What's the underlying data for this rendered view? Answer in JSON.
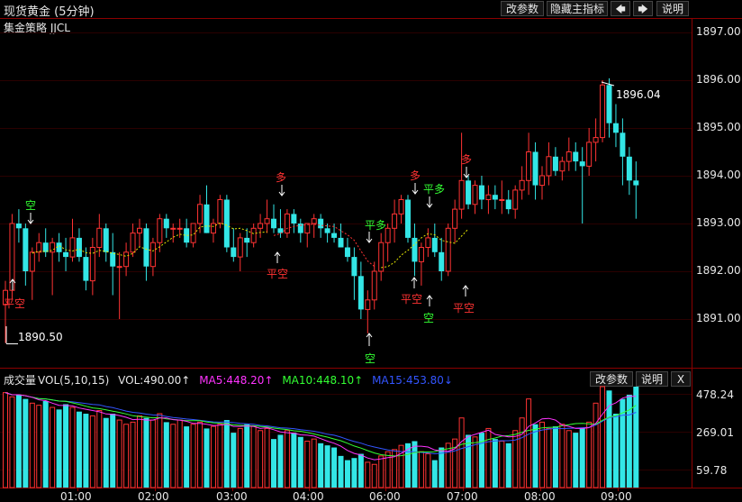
{
  "window": {
    "title": "现货黄金 (5分钟)"
  },
  "toolbar": {
    "modify_params": "改参数",
    "hide_main_indicator": "隐藏主指标",
    "prev_arrow": "🡄",
    "next_arrow": "🡆",
    "help": "说明"
  },
  "main_panel": {
    "indicator_name": "集金策略 JJCL",
    "high_label": "1896.04",
    "low_label": "1890.50",
    "price_axis": [
      "1897.00",
      "1896.00",
      "1895.00",
      "1894.00",
      "1893.00",
      "1892.00",
      "1891.00"
    ]
  },
  "volume_panel": {
    "name": "成交量",
    "indicator": "VOL(5,10,15)",
    "vol_value": "VOL:490.00↑",
    "ma5": "MA5:448.20↑",
    "ma10": "MA10:448.10↑",
    "ma15": "MA15:453.80↓",
    "modify_params": "改参数",
    "help": "说明",
    "close": "X",
    "axis": [
      "478.24",
      "269.01",
      "59.78"
    ]
  },
  "time_axis": [
    "01:00",
    "02:00",
    "03:00",
    "04:00",
    "06:00",
    "07:00",
    "08:00",
    "09:00"
  ],
  "signals": [
    "平空",
    "空",
    "多",
    "平空",
    "平多",
    "空",
    "多",
    "平多",
    "平空",
    "空",
    "多",
    "平空"
  ],
  "colors": {
    "up": "#ff3333",
    "down": "#33e6e6",
    "ma_main": "#e6e600",
    "ma5": "#ff33ff",
    "ma10": "#33ff33",
    "ma15": "#3355ff"
  },
  "chart_data": [
    {
      "type": "candlestick",
      "title": "现货黄金 (5分钟)",
      "x": [
        "01:00",
        "02:00",
        "03:00",
        "04:00",
        "06:00",
        "07:00",
        "08:00",
        "09:00"
      ],
      "ylim": [
        1890.3,
        1897.1
      ],
      "highlight": {
        "high": 1896.04,
        "low": 1890.5
      },
      "candles": [
        [
          1891.3,
          1891.8,
          1890.5,
          1891.6
        ],
        [
          1891.6,
          1893.2,
          1891.4,
          1893.0
        ],
        [
          1893.0,
          1893.3,
          1892.6,
          1892.9
        ],
        [
          1892.9,
          1893.0,
          1891.7,
          1892.0
        ],
        [
          1892.0,
          1892.5,
          1891.4,
          1892.4
        ],
        [
          1892.4,
          1892.8,
          1892.2,
          1892.6
        ],
        [
          1892.6,
          1892.9,
          1892.3,
          1892.4
        ],
        [
          1892.4,
          1892.7,
          1891.5,
          1892.6
        ],
        [
          1892.6,
          1892.8,
          1892.2,
          1892.4
        ],
        [
          1892.4,
          1892.7,
          1892.0,
          1892.3
        ],
        [
          1892.3,
          1893.1,
          1892.2,
          1892.7
        ],
        [
          1892.7,
          1892.9,
          1892.2,
          1892.3
        ],
        [
          1892.3,
          1892.5,
          1891.6,
          1891.8
        ],
        [
          1891.8,
          1892.7,
          1891.5,
          1892.5
        ],
        [
          1892.5,
          1893.2,
          1892.3,
          1892.9
        ],
        [
          1892.9,
          1893.0,
          1892.2,
          1892.4
        ],
        [
          1892.4,
          1892.8,
          1891.5,
          1892.1
        ],
        [
          1892.1,
          1892.4,
          1891.0,
          1892.1
        ],
        [
          1892.1,
          1892.6,
          1891.9,
          1892.4
        ],
        [
          1892.4,
          1893.0,
          1892.3,
          1892.8
        ],
        [
          1892.8,
          1893.1,
          1892.5,
          1892.9
        ],
        [
          1892.9,
          1893.0,
          1891.8,
          1892.1
        ],
        [
          1892.1,
          1892.7,
          1891.9,
          1892.6
        ],
        [
          1892.6,
          1893.2,
          1892.4,
          1893.1
        ],
        [
          1893.1,
          1893.2,
          1892.7,
          1892.9
        ],
        [
          1892.9,
          1893.0,
          1892.6,
          1892.9
        ],
        [
          1892.9,
          1893.1,
          1892.7,
          1892.9
        ],
        [
          1892.9,
          1893.1,
          1892.5,
          1892.6
        ],
        [
          1892.6,
          1893.0,
          1892.5,
          1893.0
        ],
        [
          1893.0,
          1893.6,
          1892.8,
          1893.4
        ],
        [
          1893.4,
          1893.8,
          1892.8,
          1892.8
        ],
        [
          1892.8,
          1893.1,
          1892.6,
          1893.0
        ],
        [
          1893.0,
          1893.6,
          1892.9,
          1893.5
        ],
        [
          1893.5,
          1893.6,
          1892.4,
          1892.5
        ],
        [
          1892.5,
          1892.9,
          1892.2,
          1892.3
        ],
        [
          1892.3,
          1892.8,
          1892.0,
          1892.7
        ],
        [
          1892.7,
          1892.9,
          1892.3,
          1892.6
        ],
        [
          1892.6,
          1893.0,
          1892.5,
          1892.9
        ],
        [
          1892.9,
          1893.2,
          1892.7,
          1893.0
        ],
        [
          1893.0,
          1893.5,
          1892.8,
          1893.1
        ],
        [
          1893.1,
          1893.4,
          1892.8,
          1892.9
        ],
        [
          1892.9,
          1893.3,
          1892.7,
          1892.8
        ],
        [
          1892.8,
          1893.3,
          1892.7,
          1893.2
        ],
        [
          1893.2,
          1893.3,
          1892.8,
          1893.0
        ],
        [
          1893.0,
          1893.1,
          1892.6,
          1892.8
        ],
        [
          1892.8,
          1893.0,
          1892.5,
          1893.0
        ],
        [
          1893.0,
          1893.2,
          1892.7,
          1893.1
        ],
        [
          1893.1,
          1893.2,
          1892.7,
          1892.9
        ],
        [
          1892.9,
          1893.0,
          1892.6,
          1892.8
        ],
        [
          1892.8,
          1893.0,
          1892.6,
          1892.7
        ],
        [
          1892.7,
          1893.0,
          1892.5,
          1892.5
        ],
        [
          1892.5,
          1892.7,
          1892.2,
          1892.3
        ],
        [
          1892.3,
          1892.5,
          1891.4,
          1891.9
        ],
        [
          1891.9,
          1892.2,
          1891.0,
          1891.2
        ],
        [
          1891.2,
          1891.6,
          1890.7,
          1891.4
        ],
        [
          1891.4,
          1892.2,
          1891.2,
          1892.0
        ],
        [
          1892.0,
          1892.8,
          1891.8,
          1892.6
        ],
        [
          1892.6,
          1893.0,
          1892.2,
          1892.9
        ],
        [
          1892.9,
          1893.5,
          1892.6,
          1893.2
        ],
        [
          1893.2,
          1893.6,
          1893.0,
          1893.5
        ],
        [
          1893.5,
          1893.6,
          1892.6,
          1892.7
        ],
        [
          1892.7,
          1893.0,
          1891.9,
          1892.2
        ],
        [
          1892.2,
          1892.6,
          1891.7,
          1892.5
        ],
        [
          1892.5,
          1892.9,
          1892.3,
          1892.7
        ],
        [
          1892.7,
          1893.0,
          1892.3,
          1892.4
        ],
        [
          1892.4,
          1892.7,
          1891.8,
          1892.0
        ],
        [
          1892.0,
          1893.0,
          1891.9,
          1892.9
        ],
        [
          1892.9,
          1893.5,
          1892.6,
          1893.3
        ],
        [
          1893.3,
          1894.9,
          1893.1,
          1893.9
        ],
        [
          1893.9,
          1894.0,
          1893.3,
          1893.4
        ],
        [
          1893.4,
          1893.9,
          1893.2,
          1893.8
        ],
        [
          1893.8,
          1894.0,
          1893.3,
          1893.5
        ],
        [
          1893.5,
          1893.8,
          1893.2,
          1893.6
        ],
        [
          1893.6,
          1893.8,
          1893.3,
          1893.5
        ],
        [
          1893.5,
          1893.9,
          1893.2,
          1893.5
        ],
        [
          1893.5,
          1893.7,
          1893.2,
          1893.3
        ],
        [
          1893.3,
          1893.8,
          1893.1,
          1893.7
        ],
        [
          1893.7,
          1894.2,
          1893.5,
          1893.9
        ],
        [
          1893.9,
          1894.9,
          1893.6,
          1894.5
        ],
        [
          1894.5,
          1894.7,
          1893.5,
          1893.8
        ],
        [
          1893.8,
          1894.2,
          1893.5,
          1894.0
        ],
        [
          1894.0,
          1894.7,
          1893.8,
          1894.4
        ],
        [
          1894.4,
          1894.6,
          1894.0,
          1894.1
        ],
        [
          1894.1,
          1894.4,
          1893.9,
          1894.3
        ],
        [
          1894.3,
          1894.8,
          1894.1,
          1894.5
        ],
        [
          1894.5,
          1894.7,
          1894.1,
          1894.3
        ],
        [
          1894.3,
          1894.6,
          1893.0,
          1894.2
        ],
        [
          1894.2,
          1895.0,
          1894.0,
          1894.7
        ],
        [
          1894.7,
          1895.2,
          1894.3,
          1894.8
        ],
        [
          1894.8,
          1896.0,
          1894.7,
          1895.9
        ],
        [
          1895.9,
          1896.04,
          1894.8,
          1895.1
        ],
        [
          1895.1,
          1895.5,
          1894.6,
          1894.9
        ],
        [
          1894.9,
          1895.2,
          1893.8,
          1894.4
        ],
        [
          1894.4,
          1894.6,
          1893.6,
          1893.9
        ],
        [
          1893.9,
          1894.3,
          1893.1,
          1893.8
        ]
      ]
    },
    {
      "type": "bar",
      "title": "成交量 VOL(5,10,15)",
      "ylim": [
        0,
        530
      ],
      "values": [
        450,
        430,
        440,
        420,
        400,
        390,
        410,
        380,
        370,
        395,
        380,
        360,
        350,
        340,
        365,
        330,
        350,
        320,
        300,
        310,
        340,
        330,
        320,
        350,
        310,
        300,
        320,
        290,
        300,
        310,
        280,
        290,
        300,
        320,
        260,
        280,
        300,
        290,
        270,
        280,
        230,
        250,
        270,
        260,
        240,
        220,
        230,
        210,
        200,
        190,
        150,
        130,
        140,
        160,
        120,
        110,
        150,
        170,
        180,
        200,
        210,
        220,
        170,
        160,
        130,
        190,
        210,
        230,
        330,
        250,
        240,
        260,
        280,
        230,
        220,
        210,
        270,
        330,
        420,
        300,
        310,
        280,
        290,
        300,
        270,
        260,
        280,
        310,
        400,
        490,
        460,
        350,
        420,
        440,
        490
      ]
    }
  ]
}
